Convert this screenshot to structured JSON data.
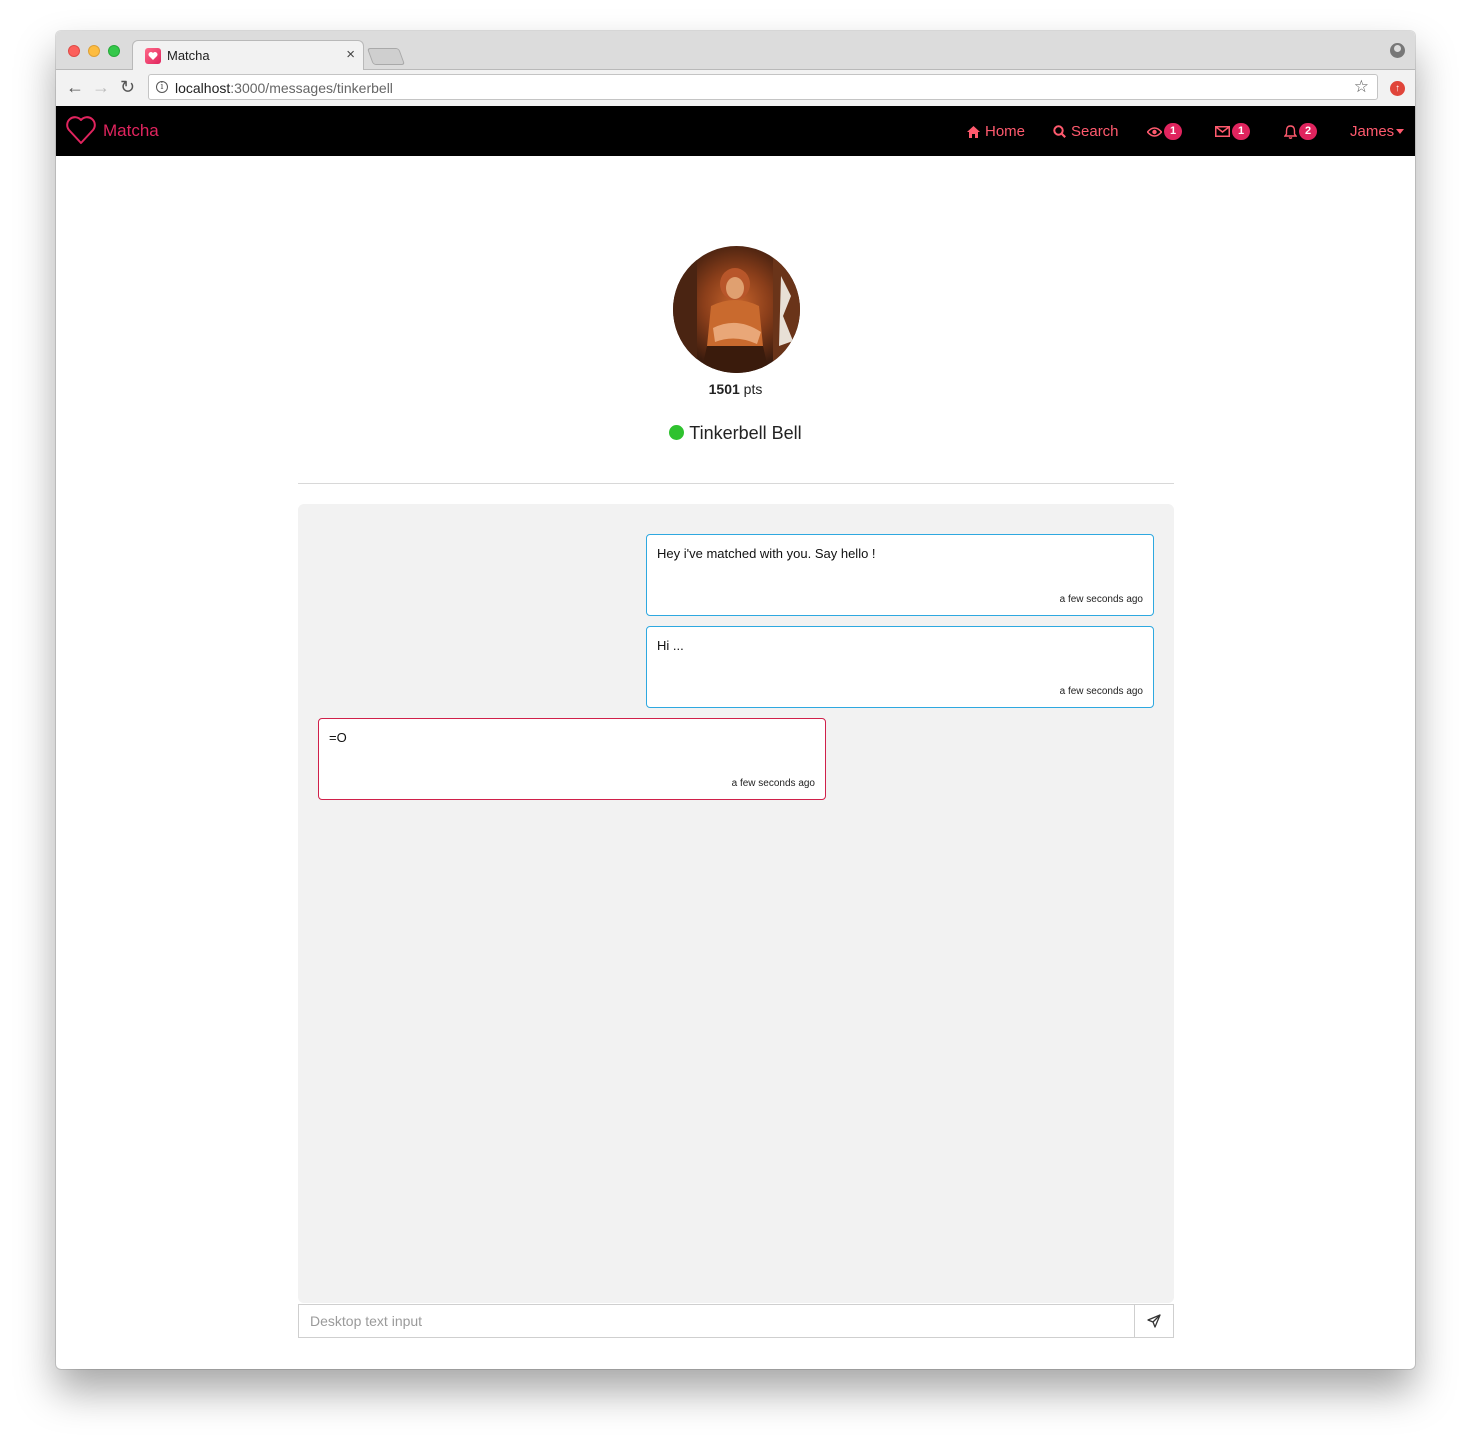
{
  "browser": {
    "tab_title": "Matcha",
    "tab_close": "×",
    "url_host": "localhost",
    "url_path": ":3000/messages/tinkerbell"
  },
  "navbar": {
    "brand": "Matcha",
    "home_label": "Home",
    "search_label": "Search",
    "views_count": "1",
    "messages_count": "1",
    "notifications_count": "2",
    "user_label": "James"
  },
  "profile": {
    "points_value": "1501",
    "points_unit": "pts",
    "name": "Tinkerbell Bell",
    "online_color": "#2fc22f"
  },
  "messages": [
    {
      "text": "Hey i've matched with you. Say hello !",
      "time": "a few seconds ago",
      "sender": "me"
    },
    {
      "text": "Hi ...",
      "time": "a few seconds ago",
      "sender": "me"
    },
    {
      "text": "=O",
      "time": "a few seconds ago",
      "sender": "them"
    }
  ],
  "composer": {
    "placeholder": "Desktop text input"
  },
  "colors": {
    "brand": "#e0245e",
    "nav_link": "#ff5a6e",
    "my_message_border": "#2ea8e0",
    "their_message_border": "#d0204a"
  }
}
